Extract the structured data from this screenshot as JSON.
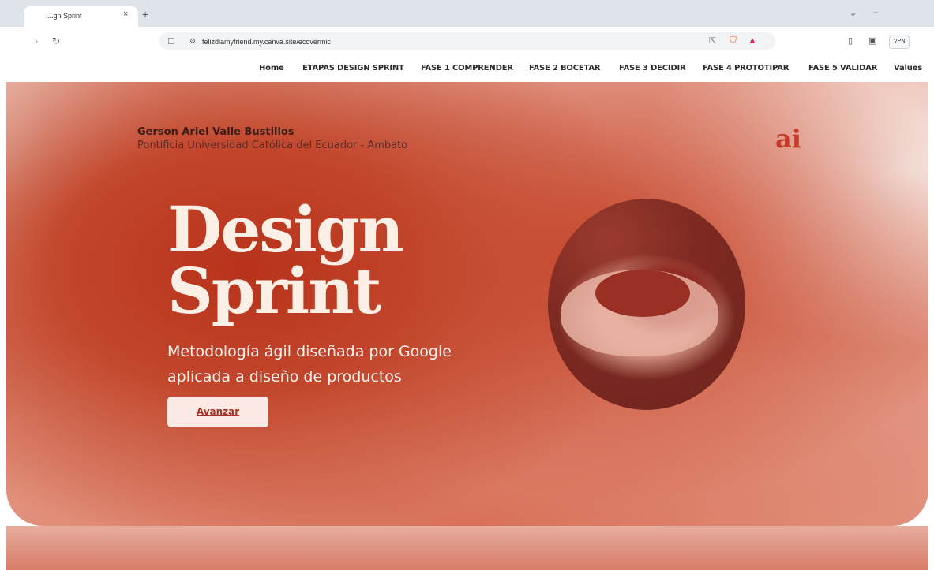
{
  "browser": {
    "tab_title": "...gn Sprint",
    "tab_close": "×",
    "new_tab": "+",
    "url": "felizdiamyfriend.my.canva.site/ecovermic",
    "vpn_label": "VPN",
    "icons": [
      "back-icon",
      "reload-icon",
      "bookmark-icon",
      "site-settings-icon",
      "share-icon",
      "brave-shield-icon",
      "brave-rewards-icon",
      "sidebar-icon",
      "wallet-icon"
    ]
  },
  "nav": {
    "items": [
      "Home",
      "ETAPAS DESIGN SPRINT",
      "FASE 1 COMPRENDER",
      "FASE 2 BOCETAR",
      "FASE 3 DECIDIR",
      "FASE 4 PROTOTIPAR",
      "FASE 5 VALIDAR",
      "Values"
    ]
  },
  "hero": {
    "author": "Gerson Ariel Valle Bustillos",
    "institution": "Pontificia Universidad Católica del Ecuador - Ambato",
    "logo_text": "ai",
    "title_line1": "Design",
    "title_line2": "Sprint",
    "subtitle": "Metodología ágil diseñada por Google aplicada a diseño de productos",
    "cta_label": "Avanzar"
  },
  "colors": {
    "accent": "#c73a2a",
    "hero_primary": "#b8321a",
    "cta_bg": "#fbeae4",
    "title_text": "#fbefe6"
  }
}
